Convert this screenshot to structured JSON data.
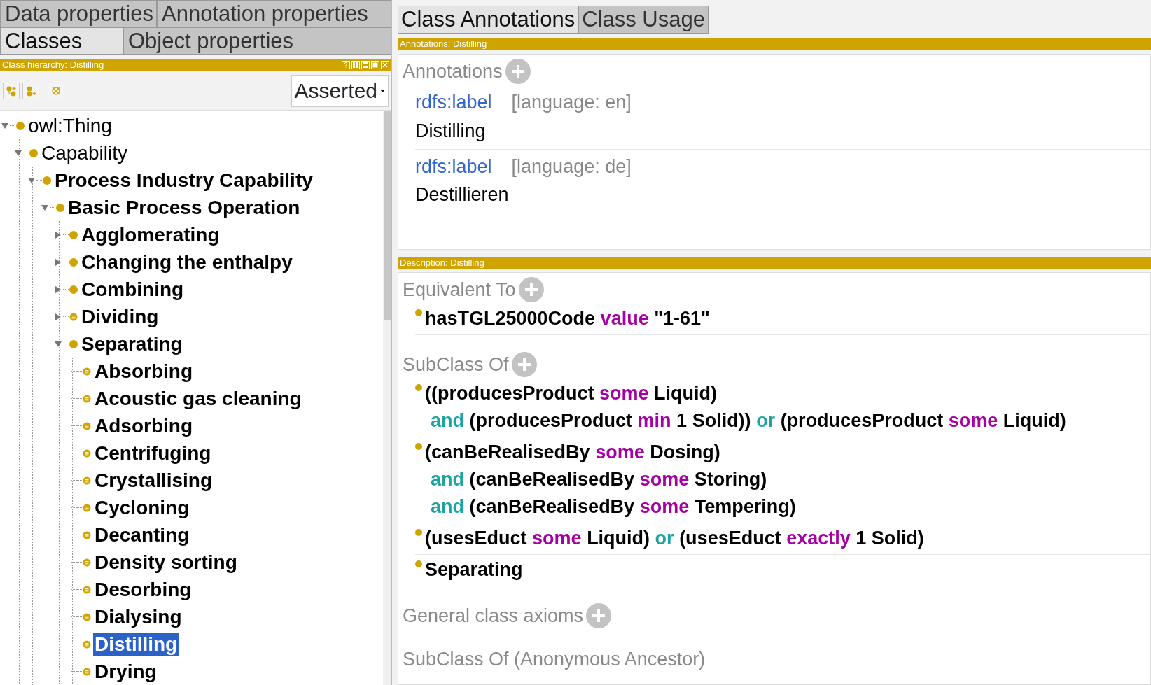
{
  "left": {
    "tab_rows": [
      [
        {
          "label": "Data properties",
          "selected": false
        },
        {
          "label": "Annotation properties",
          "selected": false
        }
      ],
      [
        {
          "label": "Classes",
          "selected": true
        },
        {
          "label": "Object properties",
          "selected": false
        }
      ]
    ],
    "view_title": "Class hierarchy: Distilling",
    "mode": "Asserted",
    "tree": [
      {
        "label": "owl:Thing",
        "expanded": true,
        "bold": false,
        "defined": false,
        "selected": false,
        "children": [
          {
            "label": "Capability",
            "expanded": true,
            "bold": false,
            "defined": false,
            "selected": false,
            "children": [
              {
                "label": "Process Industry Capability",
                "expanded": true,
                "bold": true,
                "defined": false,
                "selected": false,
                "children": [
                  {
                    "label": "Basic Process Operation",
                    "expanded": true,
                    "bold": true,
                    "defined": false,
                    "selected": false,
                    "children": [
                      {
                        "label": "Agglomerating",
                        "expanded": false,
                        "bold": true,
                        "defined": false,
                        "selected": false
                      },
                      {
                        "label": "Changing the enthalpy",
                        "expanded": false,
                        "bold": true,
                        "defined": false,
                        "selected": false
                      },
                      {
                        "label": "Combining",
                        "expanded": false,
                        "bold": true,
                        "defined": false,
                        "selected": false
                      },
                      {
                        "label": "Dividing",
                        "expanded": false,
                        "bold": true,
                        "defined": true,
                        "selected": false
                      },
                      {
                        "label": "Separating",
                        "expanded": true,
                        "bold": true,
                        "defined": false,
                        "selected": false,
                        "children": [
                          {
                            "label": "Absorbing",
                            "bold": true,
                            "defined": true,
                            "selected": false
                          },
                          {
                            "label": "Acoustic gas cleaning",
                            "bold": true,
                            "defined": true,
                            "selected": false
                          },
                          {
                            "label": "Adsorbing",
                            "bold": true,
                            "defined": true,
                            "selected": false
                          },
                          {
                            "label": "Centrifuging",
                            "bold": true,
                            "defined": true,
                            "selected": false
                          },
                          {
                            "label": "Crystallising",
                            "bold": true,
                            "defined": true,
                            "selected": false
                          },
                          {
                            "label": "Cycloning",
                            "bold": true,
                            "defined": true,
                            "selected": false
                          },
                          {
                            "label": "Decanting",
                            "bold": true,
                            "defined": true,
                            "selected": false
                          },
                          {
                            "label": "Density sorting",
                            "bold": true,
                            "defined": true,
                            "selected": false
                          },
                          {
                            "label": "Desorbing",
                            "bold": true,
                            "defined": true,
                            "selected": false
                          },
                          {
                            "label": "Dialysing",
                            "bold": true,
                            "defined": true,
                            "selected": false
                          },
                          {
                            "label": "Distilling",
                            "bold": true,
                            "defined": true,
                            "selected": true
                          },
                          {
                            "label": "Drying",
                            "bold": true,
                            "defined": true,
                            "selected": false
                          }
                        ]
                      }
                    ]
                  }
                ]
              }
            ]
          }
        ]
      }
    ]
  },
  "right": {
    "tabs": [
      {
        "label": "Class Annotations",
        "selected": true
      },
      {
        "label": "Class Usage",
        "selected": false
      }
    ],
    "annotations_title": "Annotations: Distilling",
    "annotations_header": "Annotations",
    "annotations": [
      {
        "property": "rdfs:label",
        "language": "[language: en]",
        "value": "Distilling"
      },
      {
        "property": "rdfs:label",
        "language": "[language: de]",
        "value": "Destillieren"
      }
    ],
    "description_title": "Description: Distilling",
    "sections": [
      {
        "title": "Equivalent To",
        "add": true,
        "axioms": [
          {
            "lines": [
              [
                {
                  "text": "hasTGL25000Code",
                  "kind": "name"
                },
                {
                  "text": "value",
                  "kind": "keyword"
                },
                {
                  "text": "\"1-61\"",
                  "kind": "name"
                }
              ]
            ]
          }
        ]
      },
      {
        "title": "SubClass Of",
        "add": true,
        "axioms": [
          {
            "lines": [
              [
                {
                  "text": "((producesProduct",
                  "kind": "name"
                },
                {
                  "text": "some",
                  "kind": "keyword"
                },
                {
                  "text": "Liquid)",
                  "kind": "name"
                }
              ],
              [
                {
                  "text": "and",
                  "kind": "connective"
                },
                {
                  "text": "(producesProduct",
                  "kind": "name"
                },
                {
                  "text": "min",
                  "kind": "keyword"
                },
                {
                  "text": "1 Solid))",
                  "kind": "name"
                },
                {
                  "text": "or",
                  "kind": "connective"
                },
                {
                  "text": "(producesProduct",
                  "kind": "name"
                },
                {
                  "text": "some",
                  "kind": "keyword"
                },
                {
                  "text": "Liquid)",
                  "kind": "name"
                }
              ]
            ]
          },
          {
            "lines": [
              [
                {
                  "text": "(canBeRealisedBy",
                  "kind": "name"
                },
                {
                  "text": "some",
                  "kind": "keyword"
                },
                {
                  "text": "Dosing)",
                  "kind": "name"
                }
              ],
              [
                {
                  "text": "and",
                  "kind": "connective"
                },
                {
                  "text": "(canBeRealisedBy",
                  "kind": "name"
                },
                {
                  "text": "some",
                  "kind": "keyword"
                },
                {
                  "text": "Storing)",
                  "kind": "name"
                }
              ],
              [
                {
                  "text": "and",
                  "kind": "connective"
                },
                {
                  "text": "(canBeRealisedBy",
                  "kind": "name"
                },
                {
                  "text": "some",
                  "kind": "keyword"
                },
                {
                  "text": "Tempering)",
                  "kind": "name"
                }
              ]
            ]
          },
          {
            "lines": [
              [
                {
                  "text": "(usesEduct",
                  "kind": "name"
                },
                {
                  "text": "some",
                  "kind": "keyword"
                },
                {
                  "text": "Liquid)",
                  "kind": "name"
                },
                {
                  "text": "or",
                  "kind": "connective"
                },
                {
                  "text": "(usesEduct",
                  "kind": "name"
                },
                {
                  "text": "exactly",
                  "kind": "keyword"
                },
                {
                  "text": "1 Solid)",
                  "kind": "name"
                }
              ]
            ]
          },
          {
            "lines": [
              [
                {
                  "text": "Separating",
                  "kind": "name"
                }
              ]
            ]
          }
        ]
      },
      {
        "title": "General class axioms",
        "add": true
      },
      {
        "title": "SubClass Of (Anonymous Ancestor)",
        "add": false
      }
    ]
  }
}
